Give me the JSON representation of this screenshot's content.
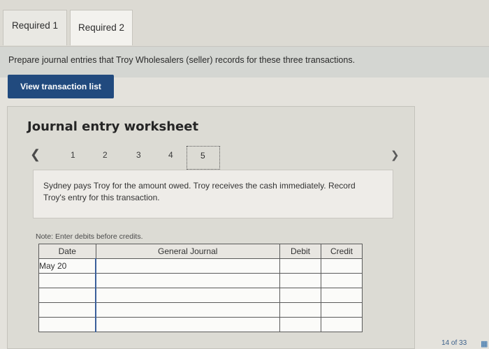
{
  "tabs": [
    {
      "label": "Required 1"
    },
    {
      "label": "Required 2"
    }
  ],
  "instruction": "Prepare journal entries that Troy Wholesalers (seller) records for these three transactions.",
  "view_button": "View transaction list",
  "worksheet": {
    "title": "Journal entry worksheet",
    "pages": [
      "1",
      "2",
      "3",
      "4",
      "5"
    ],
    "active_page": "5",
    "prev_icon": "chevron-left-icon",
    "next_icon": "chevron-right-icon",
    "description": "Sydney pays Troy for the amount owed. Troy receives the cash immediately. Record Troy's entry for this transaction.",
    "note_label": "Note: Enter debits before credits.",
    "table": {
      "headers": {
        "date": "Date",
        "account": "General Journal",
        "debit": "Debit",
        "credit": "Credit"
      },
      "rows": [
        {
          "date": "May 20",
          "account": "",
          "debit": "",
          "credit": ""
        },
        {
          "date": "",
          "account": "",
          "debit": "",
          "credit": ""
        },
        {
          "date": "",
          "account": "",
          "debit": "",
          "credit": ""
        },
        {
          "date": "",
          "account": "",
          "debit": "",
          "credit": ""
        },
        {
          "date": "",
          "account": "",
          "debit": "",
          "credit": ""
        }
      ]
    }
  },
  "footer": {
    "page_count": "14 of 33"
  },
  "colors": {
    "accent": "#214a7e",
    "background": "#e4e2dc"
  }
}
